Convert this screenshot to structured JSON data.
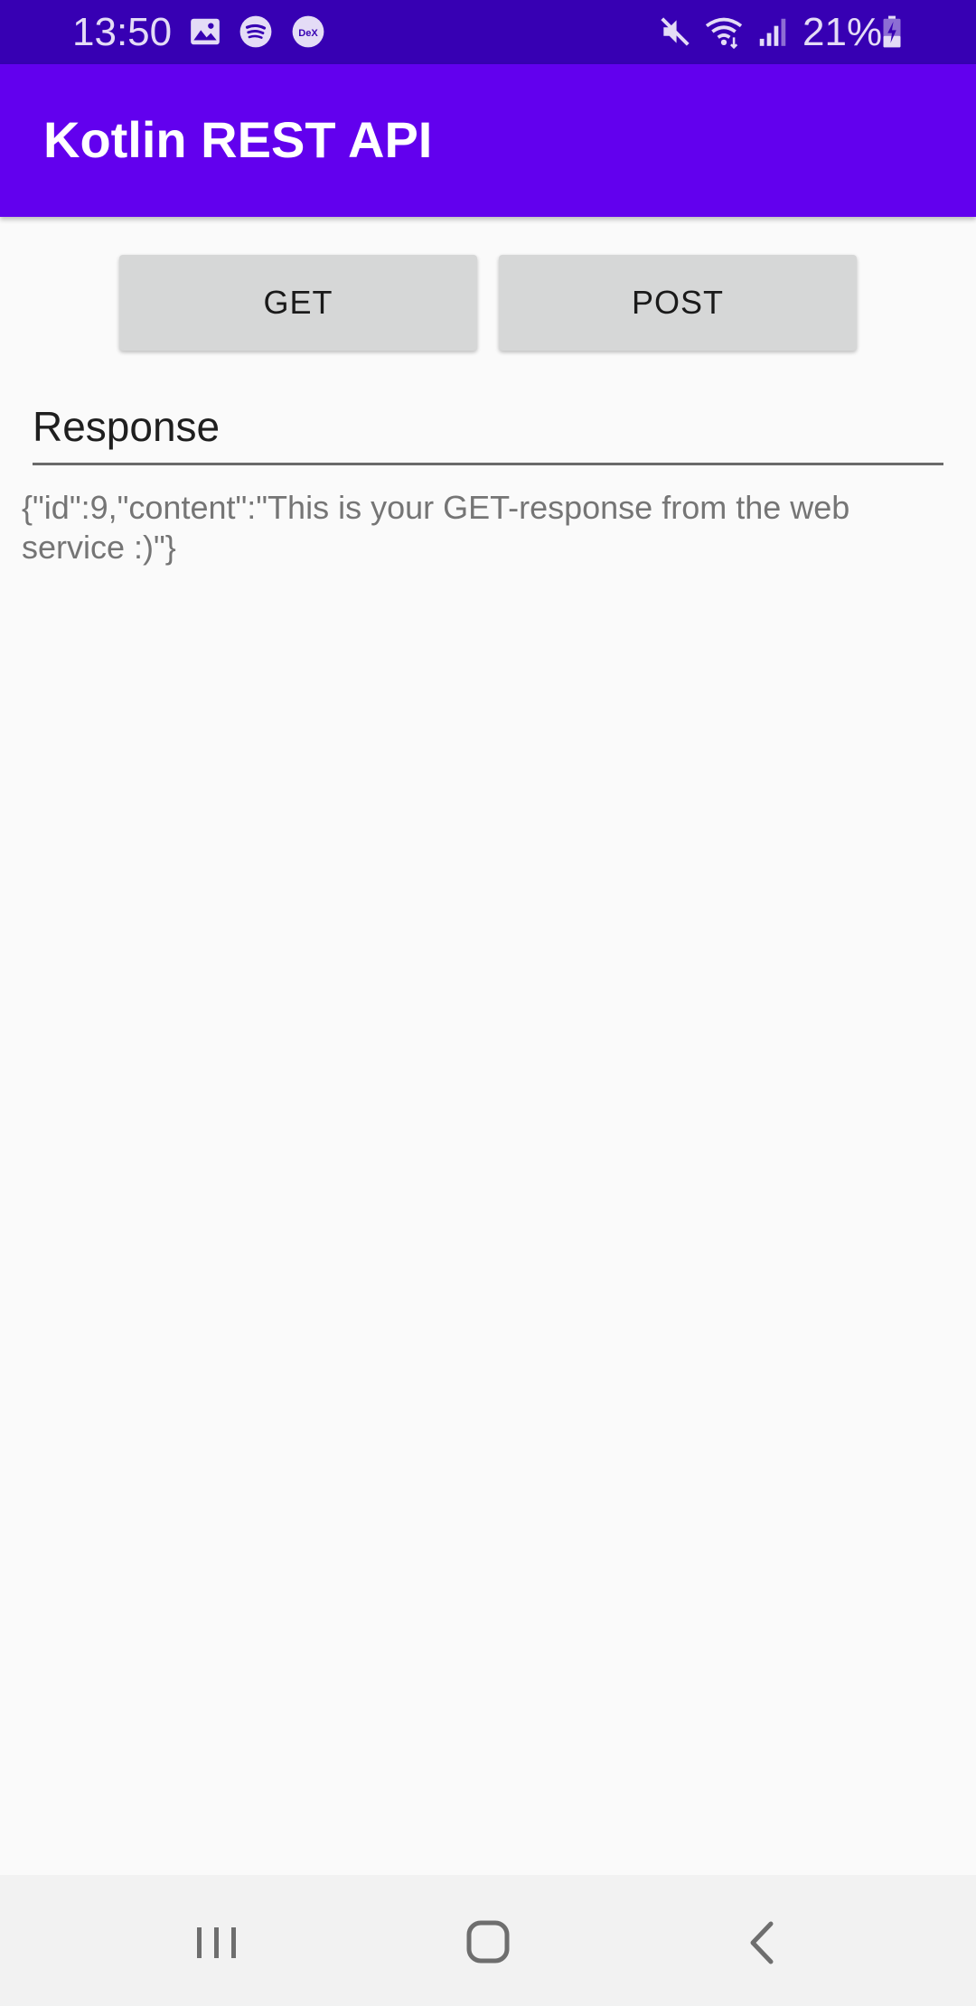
{
  "status_bar": {
    "time": "13:50",
    "battery_percent": "21%",
    "icons_left": [
      "image-icon",
      "spotify-icon",
      "dex-icon"
    ],
    "icons_right": [
      "mute-icon",
      "wifi-icon",
      "signal-icon",
      "battery-charging-icon"
    ]
  },
  "app_bar": {
    "title": "Kotlin REST API",
    "color": "#6200ee"
  },
  "buttons": {
    "get_label": "GET",
    "post_label": "POST"
  },
  "response_field": {
    "value": "Response"
  },
  "response_text": "{\"id\":9,\"content\":\"This is your GET-response from the web service :)\"}",
  "nav_bar": {
    "icons": [
      "recents-icon",
      "home-icon",
      "back-icon"
    ]
  }
}
